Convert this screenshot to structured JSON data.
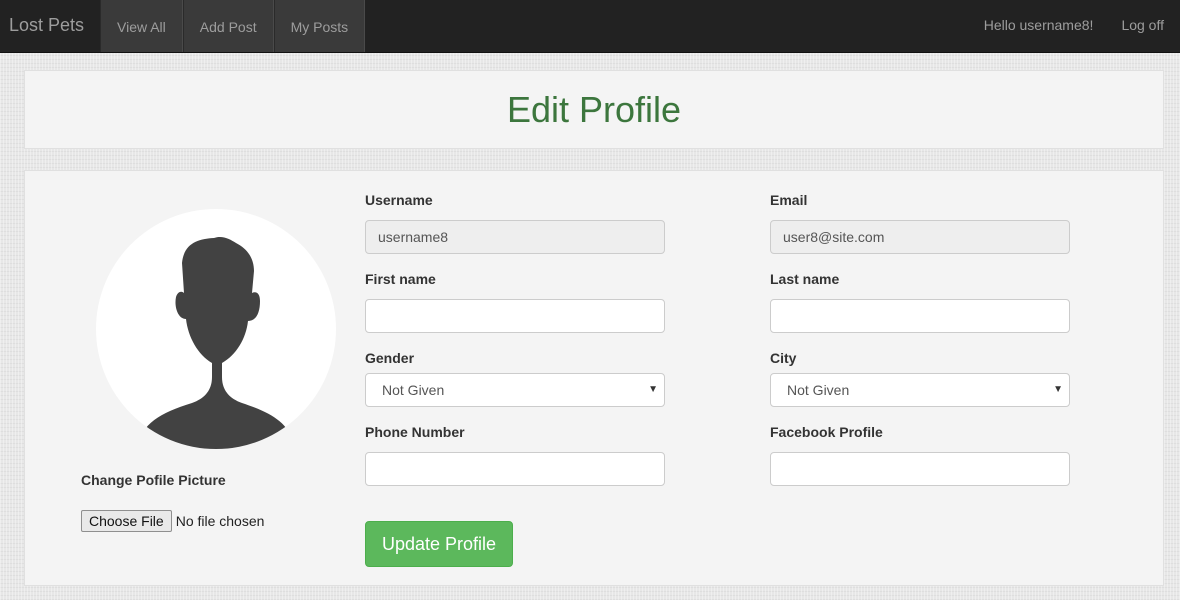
{
  "navbar": {
    "brand": "Lost Pets",
    "items": [
      {
        "label": "View All"
      },
      {
        "label": "Add Post"
      },
      {
        "label": "My Posts"
      }
    ],
    "greeting": "Hello username8!",
    "logoff": "Log off"
  },
  "page": {
    "title": "Edit Profile"
  },
  "profile_picture": {
    "change_label": "Change Pofile Picture",
    "file_button": "Choose File",
    "file_status": "No file chosen"
  },
  "form": {
    "username": {
      "label": "Username",
      "value": "username8"
    },
    "email": {
      "label": "Email",
      "value": "user8@site.com"
    },
    "first_name": {
      "label": "First name",
      "value": ""
    },
    "last_name": {
      "label": "Last name",
      "value": ""
    },
    "gender": {
      "label": "Gender",
      "selected": "Not Given"
    },
    "city": {
      "label": "City",
      "selected": "Not Given"
    },
    "phone": {
      "label": "Phone Number",
      "value": ""
    },
    "facebook": {
      "label": "Facebook Profile",
      "value": ""
    },
    "submit_label": "Update Profile"
  },
  "colors": {
    "navbar_bg": "#222222",
    "title_green": "#3c763d",
    "button_green": "#5cb85c"
  }
}
